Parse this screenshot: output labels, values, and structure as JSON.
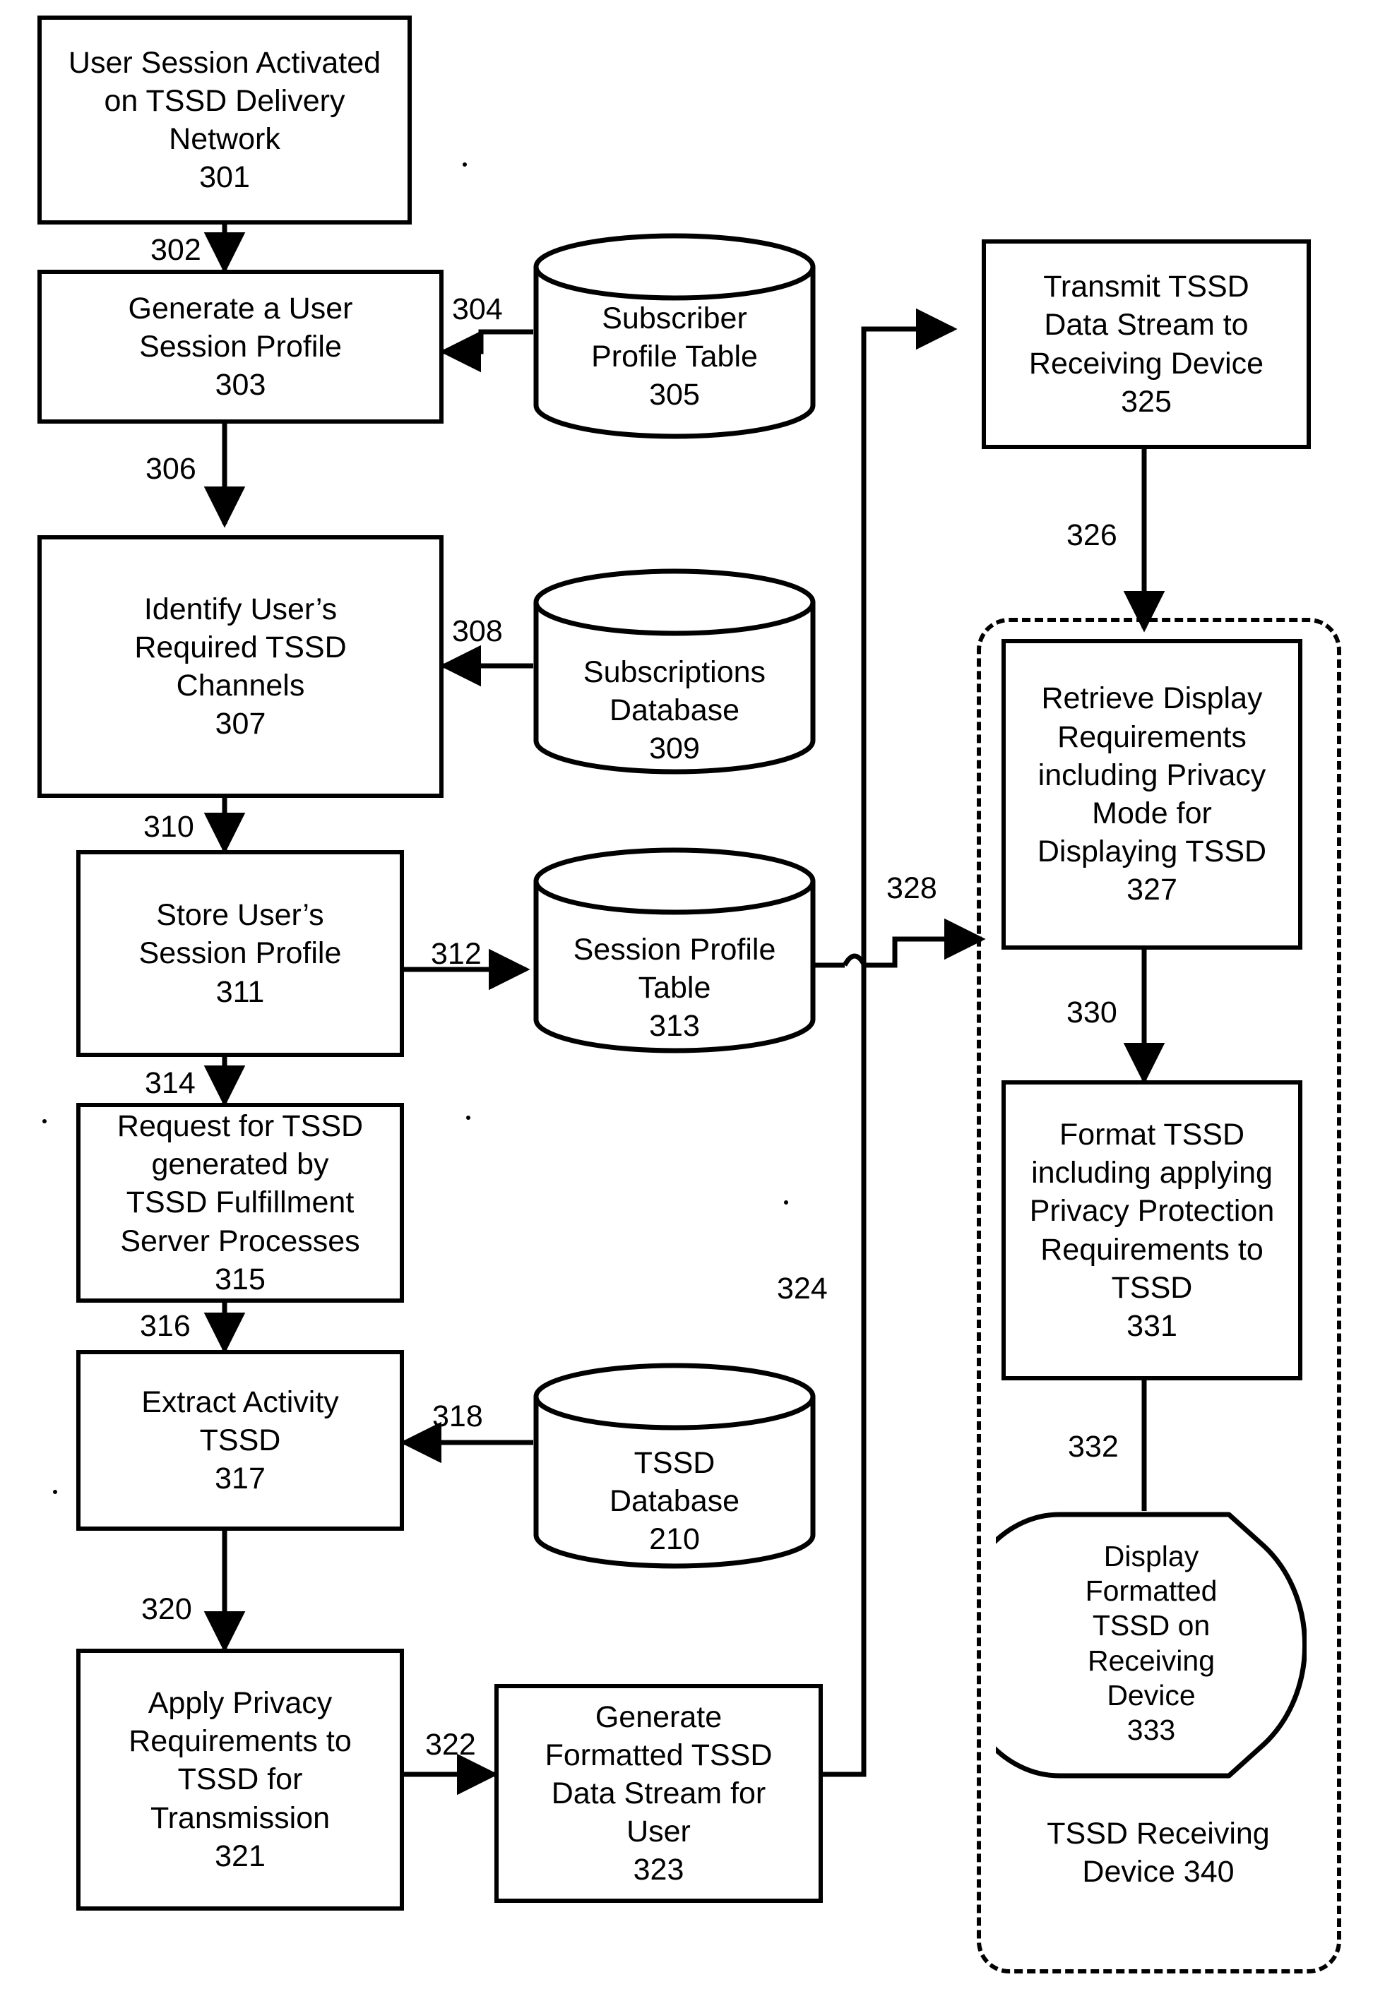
{
  "figure": {
    "type": "patent-flowchart",
    "title": "TSSD session / privacy delivery process flow"
  },
  "nodes": {
    "n301": {
      "id": "301",
      "label": "User Session Activated\non TSSD Delivery\nNetwork\n301",
      "shape": "process"
    },
    "n303": {
      "id": "303",
      "label": "Generate a User\nSession Profile\n303",
      "shape": "process"
    },
    "n305": {
      "id": "305",
      "label": "Subscriber\nProfile Table\n305",
      "shape": "database"
    },
    "n307": {
      "id": "307",
      "label": "Identify User’s\nRequired TSSD\nChannels\n307",
      "shape": "process"
    },
    "n309": {
      "id": "309",
      "label": "Subscriptions\nDatabase\n309",
      "shape": "database"
    },
    "n311": {
      "id": "311",
      "label": "Store User’s\nSession Profile\n311",
      "shape": "process"
    },
    "n313": {
      "id": "313",
      "label": "Session Profile\nTable\n313",
      "shape": "database"
    },
    "n315": {
      "id": "315",
      "label": "Request for TSSD\ngenerated by\nTSSD Fulfillment\nServer Processes\n315",
      "shape": "process"
    },
    "n317": {
      "id": "317",
      "label": "Extract Activity\nTSSD\n317",
      "shape": "process"
    },
    "n210": {
      "id": "210",
      "label": "TSSD\nDatabase\n210",
      "shape": "database"
    },
    "n321": {
      "id": "321",
      "label": "Apply Privacy\nRequirements to\nTSSD for\nTransmission\n321",
      "shape": "process"
    },
    "n323": {
      "id": "323",
      "label": "Generate\nFormatted TSSD\nData Stream for\nUser\n323",
      "shape": "process"
    },
    "n325": {
      "id": "325",
      "label": "Transmit TSSD\nData Stream to\nReceiving Device\n325",
      "shape": "process"
    },
    "n327": {
      "id": "327",
      "label": "Retrieve Display\nRequirements\nincluding Privacy\nMode for\nDisplaying TSSD\n327",
      "shape": "process"
    },
    "n331": {
      "id": "331",
      "label": "Format TSSD\nincluding applying\nPrivacy Protection\nRequirements to\nTSSD\n331",
      "shape": "process"
    },
    "n333": {
      "id": "333",
      "label": "Display\nFormatted\nTSSD on\nReceiving\nDevice\n333",
      "shape": "display-terminator"
    }
  },
  "container": {
    "id": "340",
    "label": "TSSD Receiving\nDevice 340",
    "style": "dashed-rounded"
  },
  "edges": [
    {
      "id": "302",
      "label": "302",
      "from": "301",
      "to": "303",
      "direction": "down"
    },
    {
      "id": "304",
      "label": "304",
      "from": "305",
      "to": "303",
      "direction": "left"
    },
    {
      "id": "306",
      "label": "306",
      "from": "303",
      "to": "307",
      "direction": "down"
    },
    {
      "id": "308",
      "label": "308",
      "from": "309",
      "to": "307",
      "direction": "left"
    },
    {
      "id": "310",
      "label": "310",
      "from": "307",
      "to": "311",
      "direction": "down"
    },
    {
      "id": "312",
      "label": "312",
      "from": "311",
      "to": "313",
      "direction": "right"
    },
    {
      "id": "314",
      "label": "314",
      "from": "311",
      "to": "315",
      "direction": "down"
    },
    {
      "id": "316",
      "label": "316",
      "from": "315",
      "to": "317",
      "direction": "down"
    },
    {
      "id": "318",
      "label": "318",
      "from": "210",
      "to": "317",
      "direction": "left"
    },
    {
      "id": "320",
      "label": "320",
      "from": "317",
      "to": "321",
      "direction": "down"
    },
    {
      "id": "322",
      "label": "322",
      "from": "321",
      "to": "323",
      "direction": "right"
    },
    {
      "id": "324",
      "label": "324",
      "from": "323",
      "to": "325",
      "direction": "up-right"
    },
    {
      "id": "326",
      "label": "326",
      "from": "325",
      "to": "327",
      "direction": "down"
    },
    {
      "id": "328",
      "label": "328",
      "from": "313",
      "to": "327",
      "direction": "right"
    },
    {
      "id": "330",
      "label": "330",
      "from": "327",
      "to": "331",
      "direction": "down"
    },
    {
      "id": "332",
      "label": "332",
      "from": "331",
      "to": "333",
      "direction": "down"
    }
  ]
}
